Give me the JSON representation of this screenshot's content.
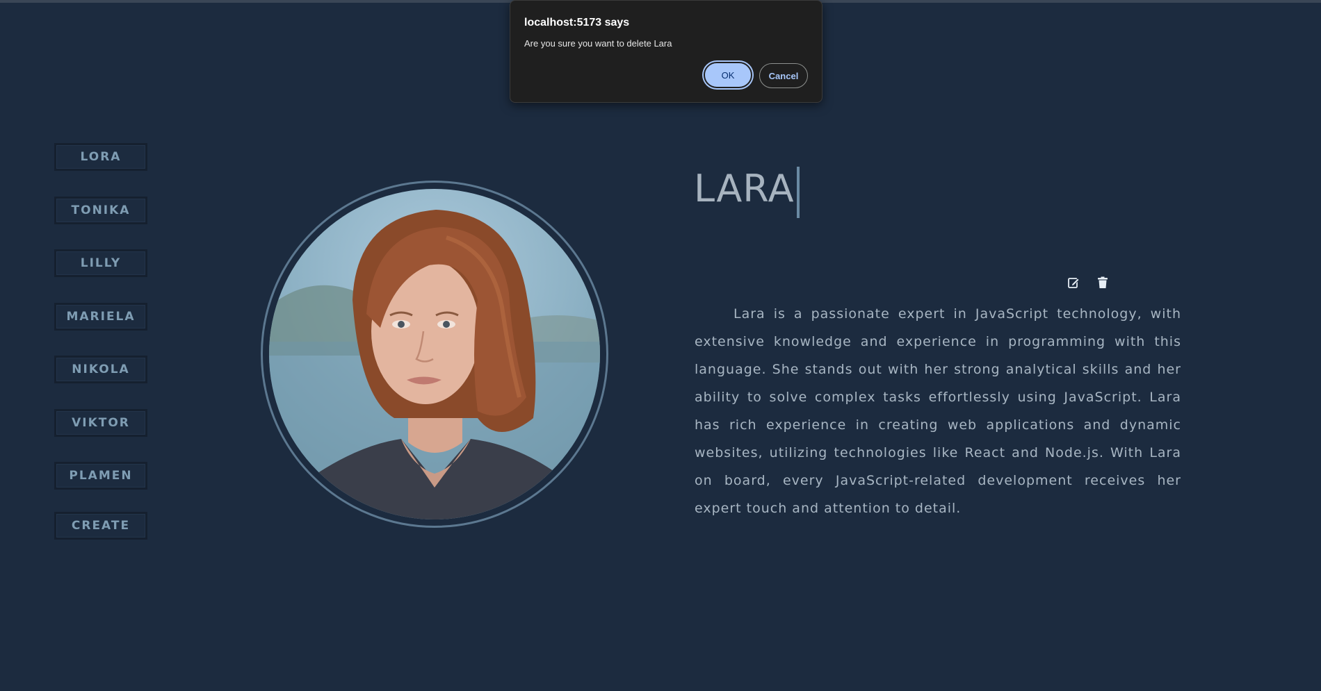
{
  "sidebar": {
    "items": [
      {
        "label": "LORA"
      },
      {
        "label": "TONIKA"
      },
      {
        "label": "LILLY"
      },
      {
        "label": "MARIELA"
      },
      {
        "label": "NIKOLA"
      },
      {
        "label": "VIKTOR"
      },
      {
        "label": "PLAMEN"
      },
      {
        "label": "CREATE"
      }
    ]
  },
  "profile": {
    "name": "LARA",
    "bio": "Lara is a passionate expert in JavaScript technology, with extensive knowledge and experience in programming with this language. She stands out with her strong analytical skills and her ability to solve complex tasks effortlessly using JavaScript. Lara has rich experience in creating web applications and dynamic websites, utilizing technologies like React and Node.js. With Lara on board, every JavaScript-related development receives her expert touch and attention to detail.",
    "edit_icon": "edit-icon",
    "delete_icon": "trash-icon"
  },
  "dialog": {
    "title": "localhost:5173 says",
    "message": "Are you sure you want to delete Lara",
    "ok_label": "OK",
    "cancel_label": "Cancel"
  },
  "colors": {
    "background": "#1c2b3f",
    "nav_text": "#7f9db3",
    "dialog_bg": "#1f1f1f",
    "ok_button": "#a8c7fa"
  }
}
